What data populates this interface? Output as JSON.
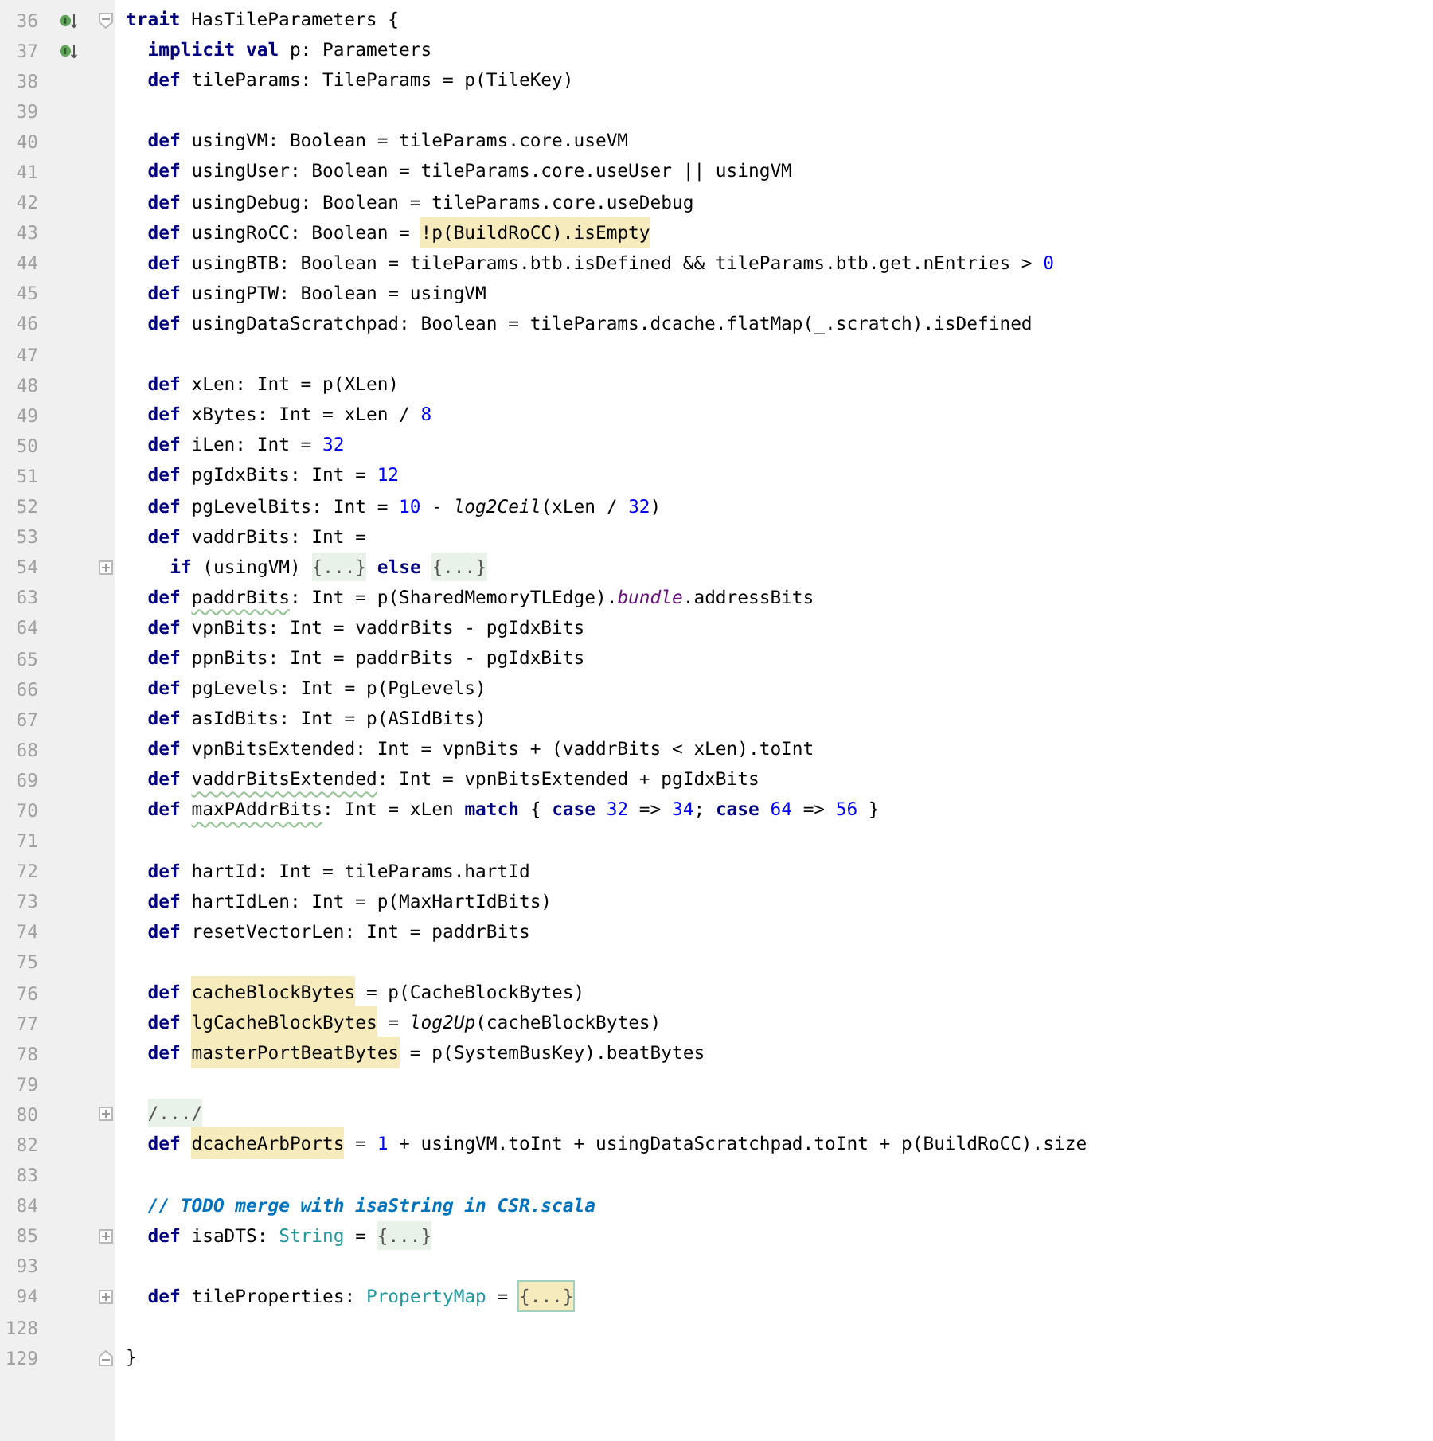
{
  "editor": {
    "lines": [
      {
        "number": "36",
        "marker": true,
        "kind": "top",
        "folded": false,
        "tokens": [
          {
            "text": "trait",
            "kind": "kw"
          },
          {
            "text": " HasTileParameters {",
            "kind": "text"
          }
        ]
      },
      {
        "number": "37",
        "marker": true,
        "kind": "member",
        "tokens": [
          {
            "text": "implicit val",
            "kind": "kw"
          },
          {
            "text": " p: Parameters",
            "kind": "text"
          }
        ]
      },
      {
        "number": "38",
        "marker": false,
        "kind": "member",
        "tokens": [
          {
            "text": "def",
            "kind": "kw"
          },
          {
            "text": " tileParams: TileParams = p(TileKey)",
            "kind": "text"
          }
        ]
      },
      {
        "number": "39",
        "marker": false
      },
      {
        "number": "40",
        "marker": false,
        "kind": "member",
        "tokens": [
          {
            "text": "def",
            "kind": "kw"
          },
          {
            "text": " usingVM: Boolean = tileParams.core.useVM",
            "kind": "text"
          }
        ]
      },
      {
        "number": "41",
        "marker": false,
        "kind": "member",
        "tokens": [
          {
            "text": "def",
            "kind": "kw"
          },
          {
            "text": " usingUser: Boolean = tileParams.core.useUser || usingVM",
            "kind": "text"
          }
        ]
      },
      {
        "number": "42",
        "marker": false,
        "kind": "member",
        "tokens": [
          {
            "text": "def",
            "kind": "kw"
          },
          {
            "text": " usingDebug: Boolean = tileParams.core.useDebug",
            "kind": "text"
          }
        ]
      },
      {
        "number": "43",
        "marker": false,
        "kind": "member",
        "tokens": [
          {
            "text": "def",
            "kind": "kw"
          },
          {
            "text": " usingRoCC: Boolean = ",
            "kind": "text"
          },
          {
            "text": "!p(BuildRoCC).isEmpty",
            "kind": "match"
          }
        ]
      },
      {
        "number": "44",
        "marker": false,
        "kind": "member",
        "tokens": [
          {
            "text": "def",
            "kind": "kw"
          },
          {
            "text": " usingBTB: Boolean = tileParams.btb.isDefined && tileParams.btb.get.nEntries > ",
            "kind": "text"
          },
          {
            "text": "0",
            "kind": "num"
          }
        ]
      },
      {
        "number": "45",
        "marker": false,
        "kind": "member",
        "tokens": [
          {
            "text": "def",
            "kind": "kw"
          },
          {
            "text": " usingPTW: Boolean = usingVM",
            "kind": "text"
          }
        ]
      },
      {
        "number": "46",
        "marker": false,
        "kind": "member",
        "tokens": [
          {
            "text": "def",
            "kind": "kw"
          },
          {
            "text": " usingDataScratchpad: Boolean = tileParams.dcache.flatMap(_.scratch).isDefined",
            "kind": "text"
          }
        ]
      },
      {
        "number": "47",
        "marker": false
      },
      {
        "number": "48",
        "marker": false,
        "kind": "member",
        "tokens": [
          {
            "text": "def",
            "kind": "kw"
          },
          {
            "text": " xLen: Int = p(XLen)",
            "kind": "text"
          }
        ]
      },
      {
        "number": "49",
        "marker": false,
        "kind": "member",
        "tokens": [
          {
            "text": "def",
            "kind": "kw"
          },
          {
            "text": " xBytes: Int = xLen / ",
            "kind": "text"
          },
          {
            "text": "8",
            "kind": "num"
          }
        ]
      },
      {
        "number": "50",
        "marker": false,
        "kind": "member",
        "tokens": [
          {
            "text": "def",
            "kind": "kw"
          },
          {
            "text": " iLen: Int = ",
            "kind": "text"
          },
          {
            "text": "32",
            "kind": "num"
          }
        ]
      },
      {
        "number": "51",
        "marker": false,
        "kind": "member",
        "tokens": [
          {
            "text": "def",
            "kind": "kw"
          },
          {
            "text": " pgIdxBits: Int = ",
            "kind": "text"
          },
          {
            "text": "12",
            "kind": "num"
          }
        ]
      },
      {
        "number": "52",
        "marker": false,
        "kind": "member",
        "tokens": [
          {
            "text": "def",
            "kind": "kw"
          },
          {
            "text": " pgLevelBits: Int = ",
            "kind": "text"
          },
          {
            "text": "10",
            "kind": "num"
          },
          {
            "text": " - ",
            "kind": "text"
          },
          {
            "text": "log2Ceil",
            "kind": "call"
          },
          {
            "text": "(xLen / ",
            "kind": "text"
          },
          {
            "text": "32",
            "kind": "num"
          },
          {
            "text": ")",
            "kind": "text"
          }
        ]
      },
      {
        "number": "53",
        "marker": false,
        "kind": "member",
        "tokens": [
          {
            "text": "def",
            "kind": "kw"
          },
          {
            "text": " vaddrBits: Int =",
            "kind": "text"
          }
        ]
      },
      {
        "number": "54",
        "marker": false,
        "kind": "nested",
        "folded": true,
        "tokens": [
          {
            "text": "if",
            "kind": "kw"
          },
          {
            "text": " (usingVM) ",
            "kind": "text"
          },
          {
            "text": "{...}",
            "kind": "folded"
          },
          {
            "text": " else ",
            "kind": "kw"
          },
          {
            "text": "{...}",
            "kind": "folded"
          }
        ]
      },
      {
        "number": "63",
        "marker": false,
        "kind": "member",
        "tokens": [
          {
            "text": "def ",
            "kind": "kw"
          },
          {
            "text": "paddrBits",
            "kind": "warn"
          },
          {
            "text": ": Int = p(SharedMemoryTLEdge).",
            "kind": "text"
          },
          {
            "text": "bundle",
            "kind": "field"
          },
          {
            "text": ".addressBits",
            "kind": "text"
          }
        ]
      },
      {
        "number": "64",
        "marker": false,
        "kind": "member",
        "tokens": [
          {
            "text": "def",
            "kind": "kw"
          },
          {
            "text": " vpnBits: Int = vaddrBits - pgIdxBits",
            "kind": "text"
          }
        ]
      },
      {
        "number": "65",
        "marker": false,
        "kind": "member",
        "tokens": [
          {
            "text": "def",
            "kind": "kw"
          },
          {
            "text": " ppnBits: Int = paddrBits - pgIdxBits",
            "kind": "text"
          }
        ]
      },
      {
        "number": "66",
        "marker": false,
        "kind": "member",
        "tokens": [
          {
            "text": "def",
            "kind": "kw"
          },
          {
            "text": " pgLevels: Int = p(PgLevels)",
            "kind": "text"
          }
        ]
      },
      {
        "number": "67",
        "marker": false,
        "kind": "member",
        "tokens": [
          {
            "text": "def",
            "kind": "kw"
          },
          {
            "text": " asIdBits: Int = p(ASIdBits)",
            "kind": "text"
          }
        ]
      },
      {
        "number": "68",
        "marker": false,
        "kind": "member",
        "tokens": [
          {
            "text": "def",
            "kind": "kw"
          },
          {
            "text": " vpnBitsExtended: Int = vpnBits + (vaddrBits < xLen).toInt",
            "kind": "text"
          }
        ]
      },
      {
        "number": "69",
        "marker": false,
        "kind": "member",
        "tokens": [
          {
            "text": "def ",
            "kind": "kw"
          },
          {
            "text": "vaddrBitsExtended",
            "kind": "warn"
          },
          {
            "text": ": Int = vpnBitsExtended + pgIdxBits",
            "kind": "text"
          }
        ]
      },
      {
        "number": "70",
        "marker": false,
        "kind": "member",
        "tokens": [
          {
            "text": "def ",
            "kind": "kw"
          },
          {
            "text": "maxPAddrBits",
            "kind": "warn"
          },
          {
            "text": ": Int = xLen ",
            "kind": "text"
          },
          {
            "text": "match",
            "kind": "kw"
          },
          {
            "text": " { ",
            "kind": "text"
          },
          {
            "text": "case ",
            "kind": "kw"
          },
          {
            "text": "32",
            "kind": "num"
          },
          {
            "text": " => ",
            "kind": "text"
          },
          {
            "text": "34",
            "kind": "num"
          },
          {
            "text": "; ",
            "kind": "text"
          },
          {
            "text": "case ",
            "kind": "kw"
          },
          {
            "text": "64",
            "kind": "num"
          },
          {
            "text": " => ",
            "kind": "text"
          },
          {
            "text": "56",
            "kind": "num"
          },
          {
            "text": " }",
            "kind": "text"
          }
        ]
      },
      {
        "number": "71",
        "marker": false
      },
      {
        "number": "72",
        "marker": false,
        "kind": "member",
        "tokens": [
          {
            "text": "def",
            "kind": "kw"
          },
          {
            "text": " hartId: Int = tileParams.hartId",
            "kind": "text"
          }
        ]
      },
      {
        "number": "73",
        "marker": false,
        "kind": "member",
        "tokens": [
          {
            "text": "def",
            "kind": "kw"
          },
          {
            "text": " hartIdLen: Int = p(MaxHartIdBits)",
            "kind": "text"
          }
        ]
      },
      {
        "number": "74",
        "marker": false,
        "kind": "member",
        "tokens": [
          {
            "text": "def",
            "kind": "kw"
          },
          {
            "text": " resetVectorLen: Int = paddrBits",
            "kind": "text"
          }
        ]
      },
      {
        "number": "75",
        "marker": false
      },
      {
        "number": "76",
        "marker": false,
        "kind": "member",
        "tokens": [
          {
            "text": "def ",
            "kind": "kw"
          },
          {
            "text": "cacheBlockBytes",
            "kind": "match"
          },
          {
            "text": " = p(CacheBlockBytes)",
            "kind": "text"
          }
        ]
      },
      {
        "number": "77",
        "marker": false,
        "kind": "member",
        "tokens": [
          {
            "text": "def ",
            "kind": "kw"
          },
          {
            "text": "lgCacheBlockBytes",
            "kind": "match"
          },
          {
            "text": " = ",
            "kind": "text"
          },
          {
            "text": "log2Up",
            "kind": "call"
          },
          {
            "text": "(cacheBlockBytes)",
            "kind": "text"
          }
        ]
      },
      {
        "number": "78",
        "marker": false,
        "kind": "member",
        "tokens": [
          {
            "text": "def ",
            "kind": "kw"
          },
          {
            "text": "masterPortBeatBytes",
            "kind": "match"
          },
          {
            "text": " = p(SystemBusKey).beatBytes",
            "kind": "text"
          }
        ]
      },
      {
        "number": "79",
        "marker": false
      },
      {
        "number": "80",
        "marker": false,
        "kind": "member",
        "folded": true,
        "tokens": [
          {
            "text": "/.../",
            "kind": "folded"
          }
        ]
      },
      {
        "number": "82",
        "marker": false,
        "kind": "member",
        "tokens": [
          {
            "text": "def ",
            "kind": "kw"
          },
          {
            "text": "dcacheArbPorts",
            "kind": "match"
          },
          {
            "text": " = ",
            "kind": "text"
          },
          {
            "text": "1",
            "kind": "num"
          },
          {
            "text": " + usingVM.toInt + usingDataScratchpad.toInt + p(BuildRoCC).size",
            "kind": "text"
          }
        ]
      },
      {
        "number": "83",
        "marker": false
      },
      {
        "number": "84",
        "marker": false,
        "kind": "member",
        "tokens": [
          {
            "text": "// TODO merge with isaString in CSR.scala",
            "kind": "comment"
          }
        ]
      },
      {
        "number": "85",
        "marker": false,
        "kind": "member",
        "folded": true,
        "tokens": [
          {
            "text": "def",
            "kind": "kw"
          },
          {
            "text": " isaDTS: ",
            "kind": "text"
          },
          {
            "text": "String",
            "kind": "type"
          },
          {
            "text": " = ",
            "kind": "text"
          },
          {
            "text": "{...}",
            "kind": "folded"
          }
        ]
      },
      {
        "number": "93",
        "marker": false
      },
      {
        "number": "94",
        "marker": false,
        "kind": "member",
        "folded": true,
        "tokens": [
          {
            "text": "def",
            "kind": "kw"
          },
          {
            "text": " tileProperties: ",
            "kind": "text"
          },
          {
            "text": "PropertyMap",
            "kind": "type"
          },
          {
            "text": " = ",
            "kind": "text"
          },
          {
            "text": "{...}",
            "kind": "folded_selected"
          }
        ]
      },
      {
        "number": "128",
        "marker": false
      },
      {
        "number": "129",
        "marker": false,
        "kind": "end",
        "folded": false,
        "tokens": [
          {
            "text": "}",
            "kind": "text"
          }
        ]
      }
    ]
  }
}
